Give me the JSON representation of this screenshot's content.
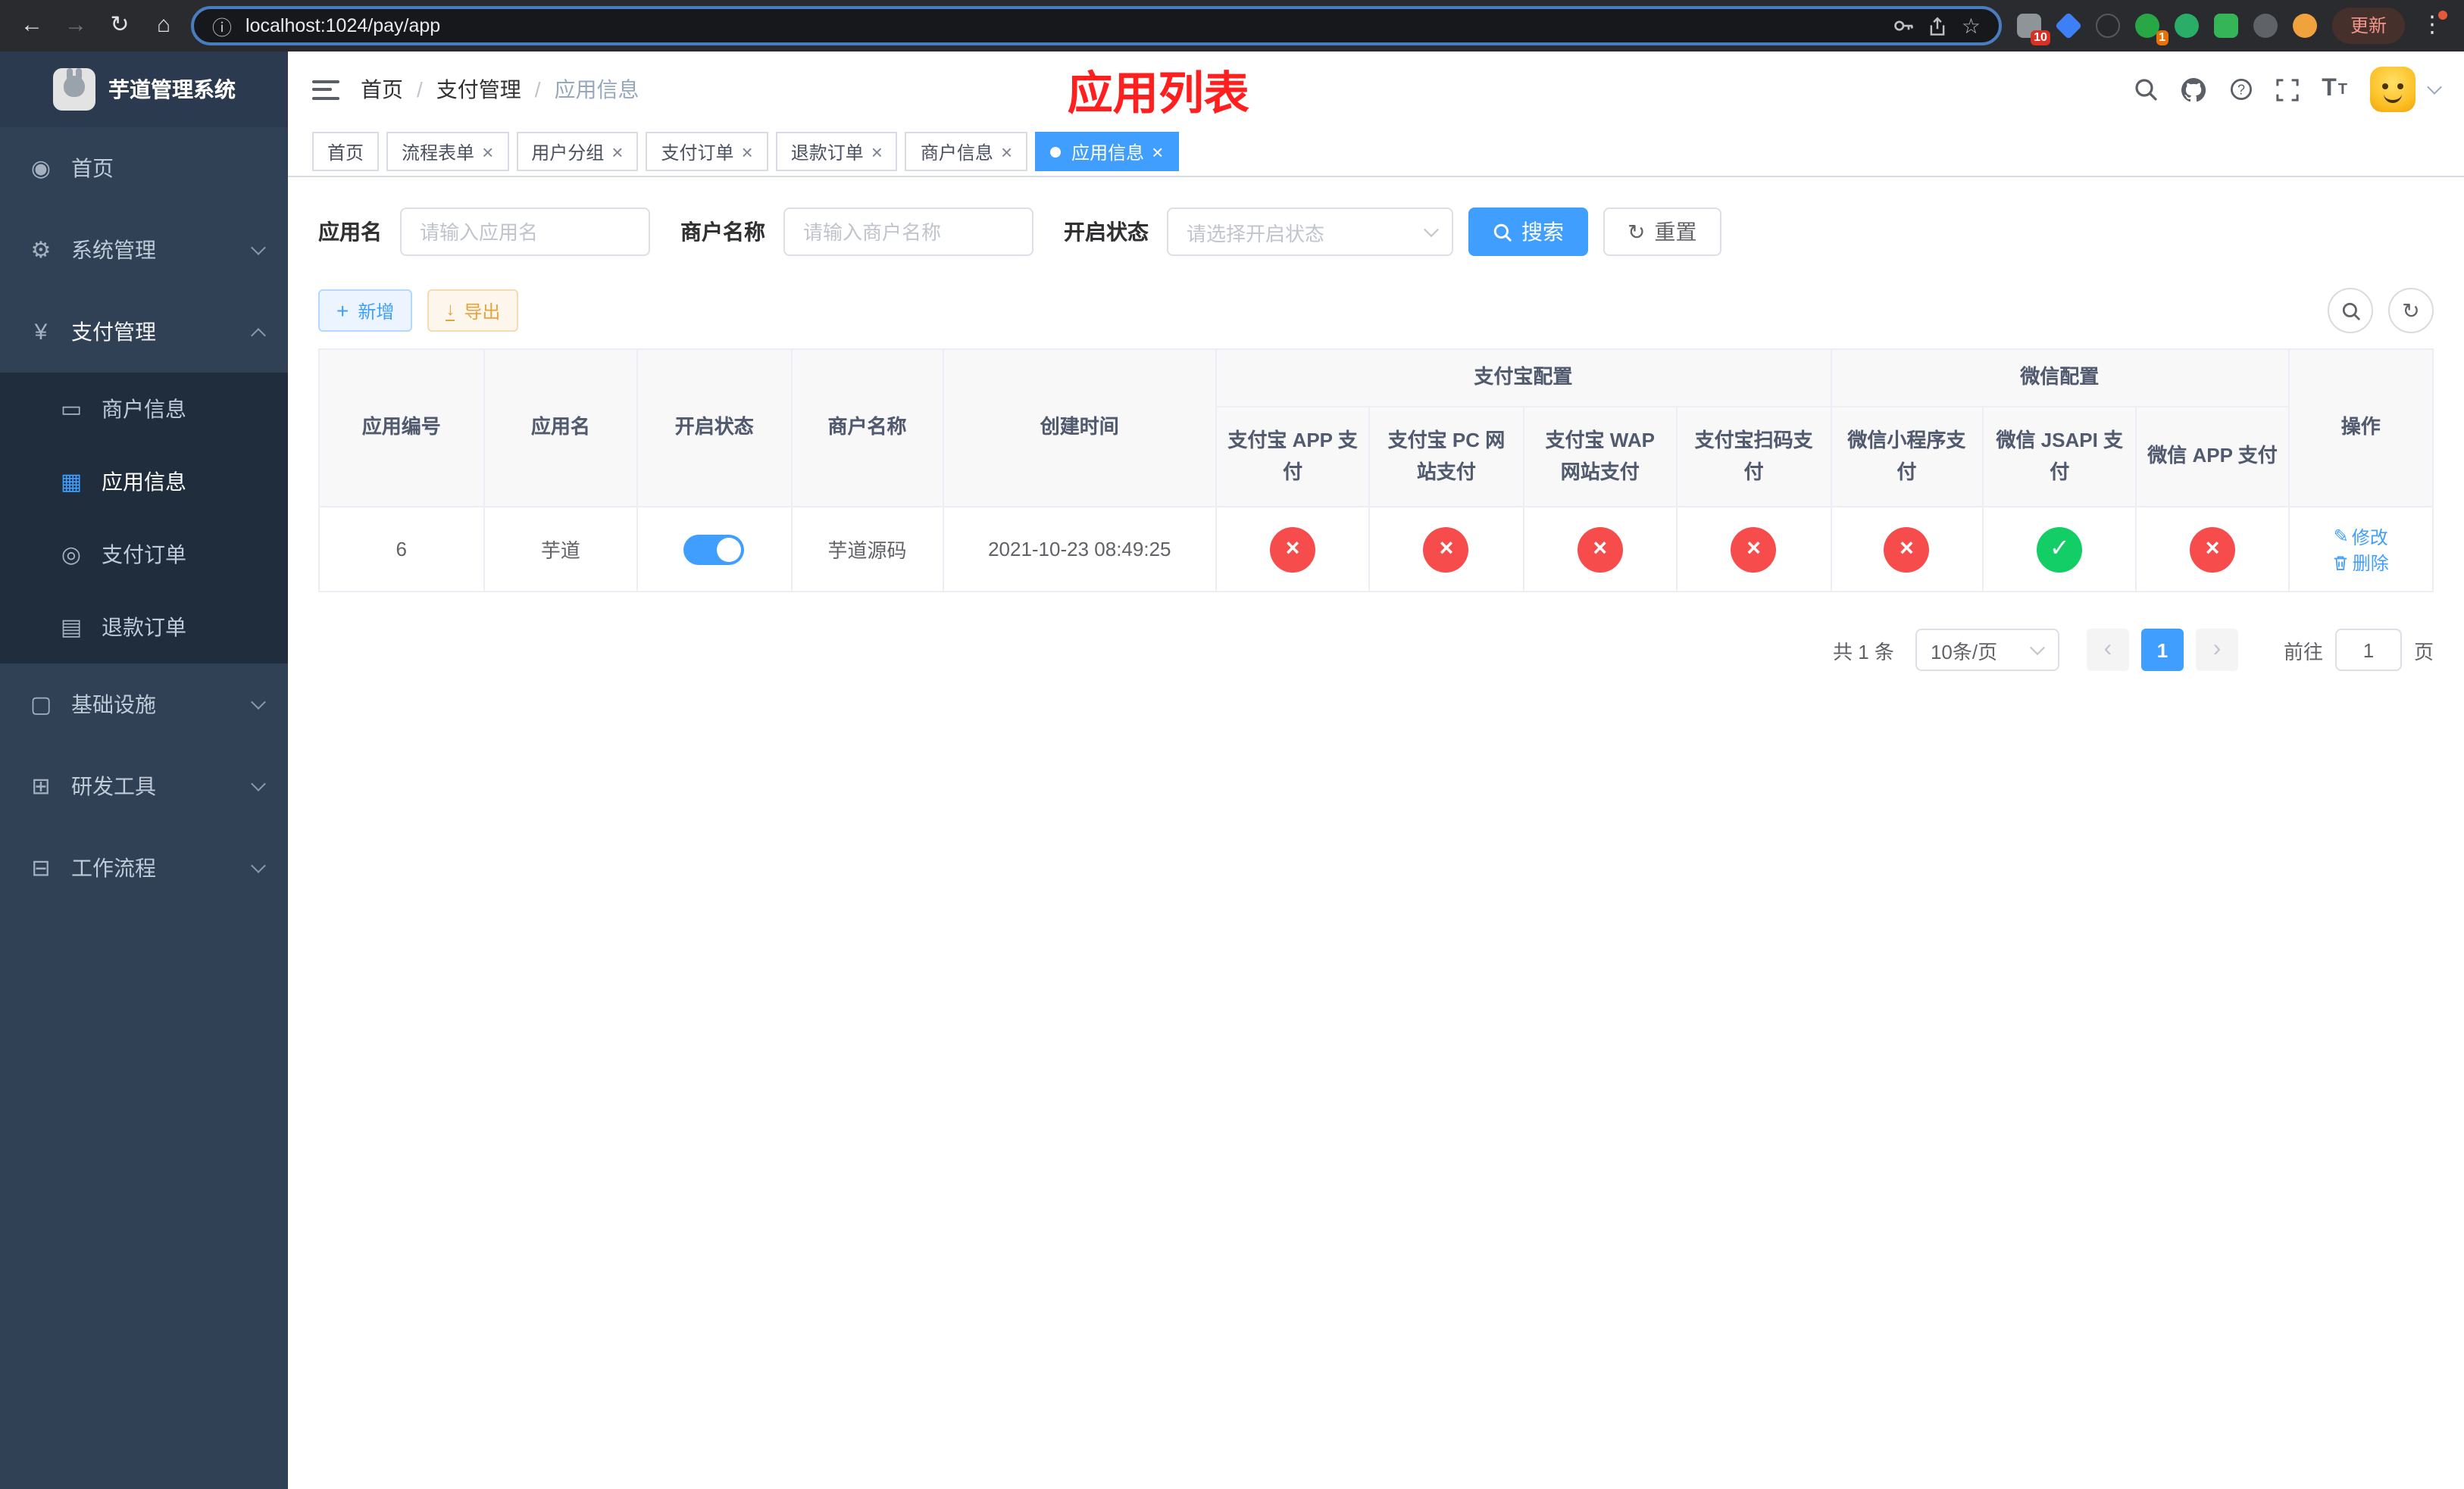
{
  "colors": {
    "primary": "#409eff",
    "success": "#13ce66",
    "danger": "#f64c4c",
    "warning": "#e6a23c",
    "title_red": "#ff1f1f"
  },
  "icons": {
    "back": "←",
    "forward": "→",
    "reload": "↻",
    "home": "⌂",
    "info": "ⓘ",
    "star": "☆",
    "more": "⋮",
    "dashboard": "◉",
    "gear": "⚙",
    "yen": "¥",
    "merchant": "▭",
    "app": "▦",
    "pay_order": "◎",
    "refund_order": "▤",
    "infra": "▢",
    "devtools": "⊞",
    "workflow": "⊟",
    "plus": "+",
    "download": "↓",
    "refresh": "↻",
    "edit": "✎",
    "close": "×",
    "check": "✓",
    "cross": "×",
    "prev": "‹",
    "next": "›"
  },
  "browser": {
    "url": "localhost:1024/pay/app",
    "update_label": "更新",
    "ext_badge_1": "10",
    "ext_badge_2": "1"
  },
  "sidebar": {
    "title": "芋道管理系统",
    "menu": {
      "home": "首页",
      "system": "系统管理",
      "payment": "支付管理",
      "merchant_info": "商户信息",
      "app_info": "应用信息",
      "pay_order": "支付订单",
      "refund_order": "退款订单",
      "infra": "基础设施",
      "devtools": "研发工具",
      "workflow": "工作流程"
    }
  },
  "navbar": {
    "breadcrumb": [
      "首页",
      "支付管理",
      "应用信息"
    ],
    "separator": "/",
    "title": "应用列表"
  },
  "tabs": [
    {
      "label": "首页",
      "closable": false,
      "active": false
    },
    {
      "label": "流程表单",
      "closable": true,
      "active": false
    },
    {
      "label": "用户分组",
      "closable": true,
      "active": false
    },
    {
      "label": "支付订单",
      "closable": true,
      "active": false
    },
    {
      "label": "退款订单",
      "closable": true,
      "active": false
    },
    {
      "label": "商户信息",
      "closable": true,
      "active": false
    },
    {
      "label": "应用信息",
      "closable": true,
      "active": true
    }
  ],
  "filter": {
    "app_name_label": "应用名",
    "app_name_placeholder": "请输入应用名",
    "merchant_label": "商户名称",
    "merchant_placeholder": "请输入商户名称",
    "status_label": "开启状态",
    "status_placeholder": "请选择开启状态",
    "search": "搜索",
    "reset": "重置"
  },
  "toolbar": {
    "add": "新增",
    "export": "导出"
  },
  "table": {
    "col_app_id": "应用编号",
    "col_app_name": "应用名",
    "col_status": "开启状态",
    "col_merchant": "商户名称",
    "col_create_time": "创建时间",
    "group_alipay": "支付宝配置",
    "group_wechat": "微信配置",
    "col_alipay_app": "支付宝 APP 支付",
    "col_alipay_pc": "支付宝 PC 网站支付",
    "col_alipay_wap": "支付宝 WAP 网站支付",
    "col_alipay_qr": "支付宝扫码支付",
    "col_wx_mini": "微信小程序支付",
    "col_wx_jsapi": "微信 JSAPI 支付",
    "col_wx_app": "微信 APP 支付",
    "col_actions": "操作",
    "rows": [
      {
        "app_id": "6",
        "app_name": "芋道",
        "status": "on",
        "merchant": "芋道源码",
        "create_time": "2021-10-23 08:49:25",
        "alipay_app": "fail",
        "alipay_pc": "fail",
        "alipay_wap": "fail",
        "alipay_qr": "fail",
        "wx_mini": "fail",
        "wx_jsapi": "success",
        "wx_app": "fail",
        "edit": "修改",
        "delete": "删除"
      }
    ]
  },
  "pagination": {
    "total": "共 1 条",
    "page_size": "10条/页",
    "page": "1",
    "goto": "前往",
    "goto_page": "1",
    "page_suffix": "页"
  }
}
